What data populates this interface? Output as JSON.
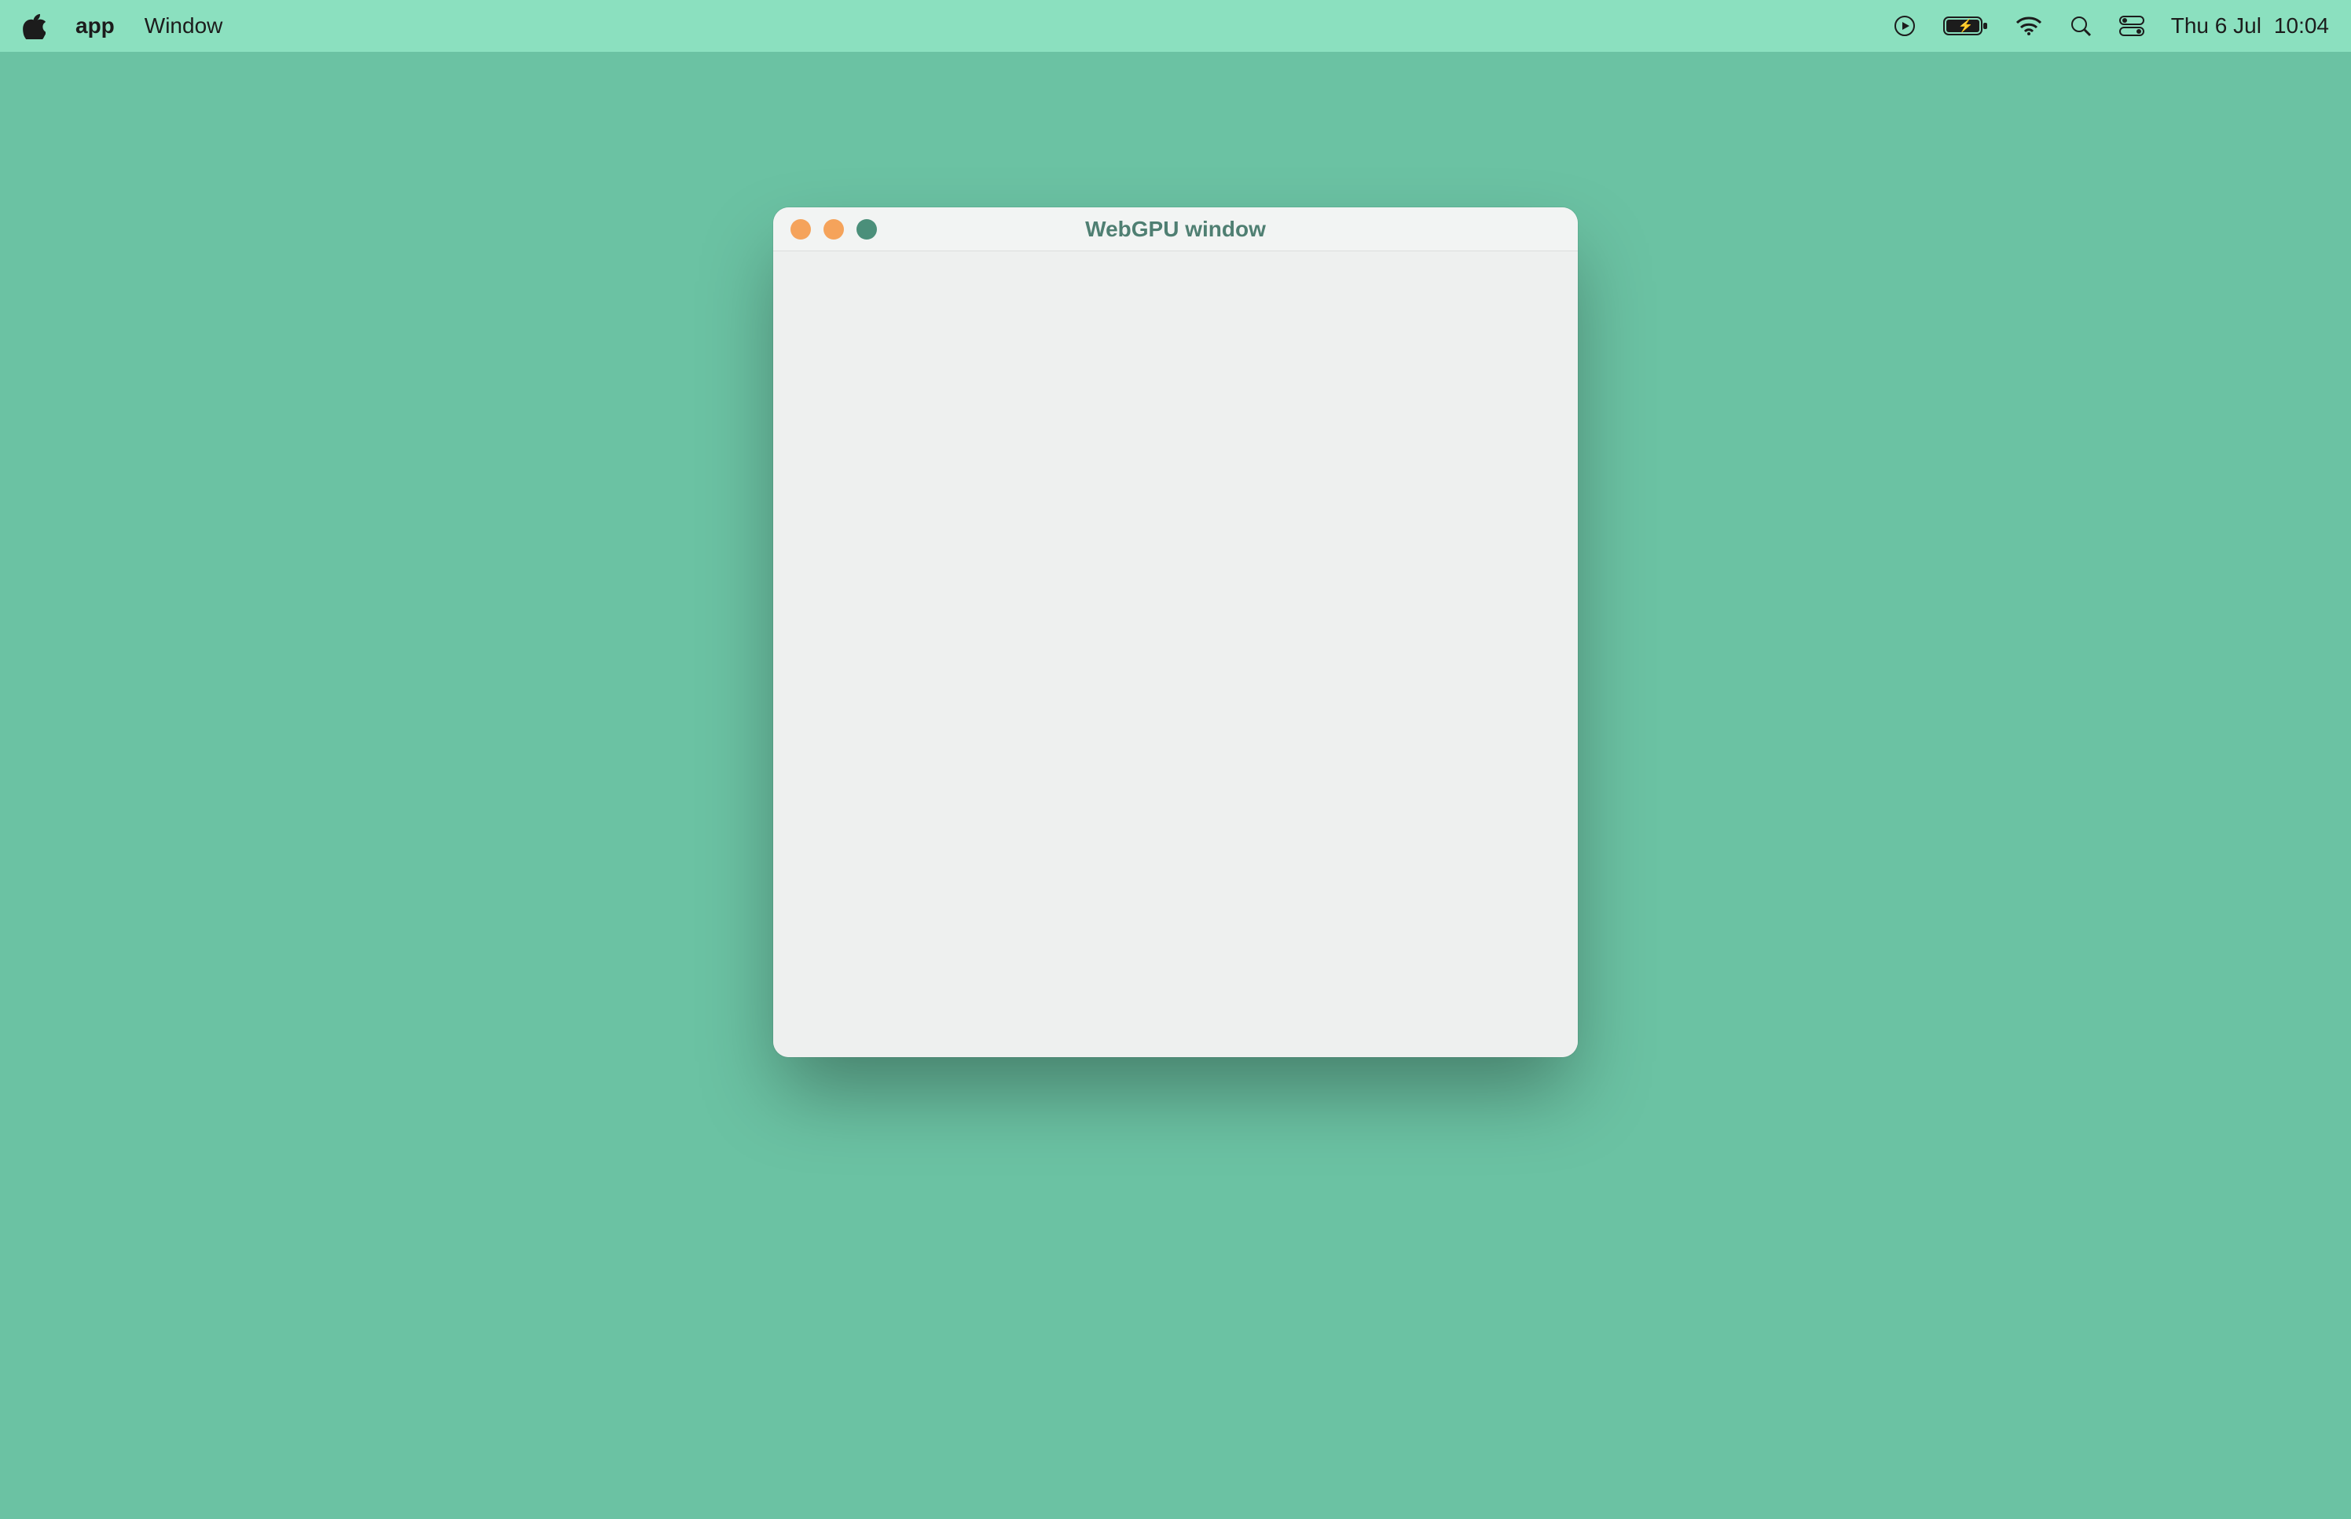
{
  "menubar": {
    "app_name": "app",
    "items": [
      "Window"
    ],
    "date": "Thu 6 Jul",
    "time": "10:04"
  },
  "window": {
    "title": "WebGPU window"
  }
}
